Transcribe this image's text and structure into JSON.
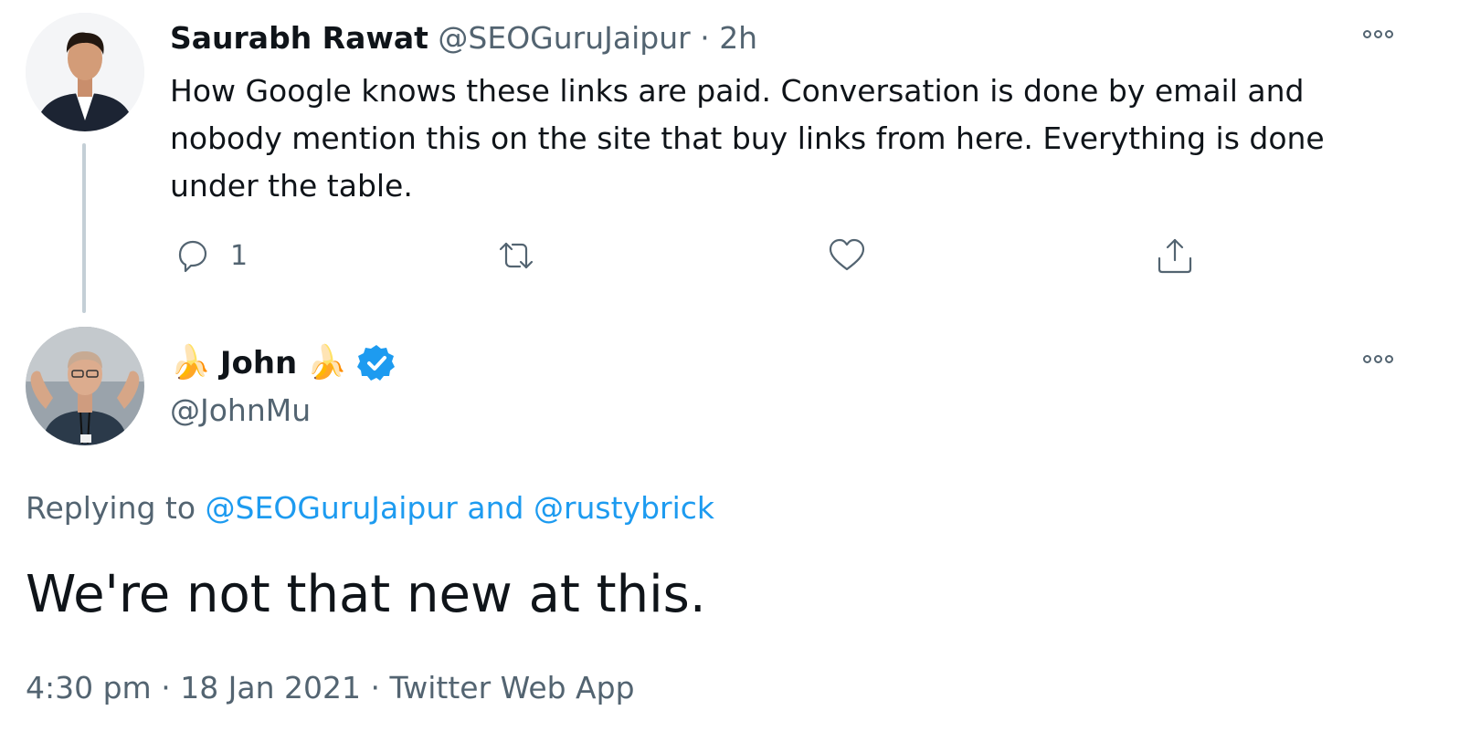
{
  "parent_tweet": {
    "author_name": "Saurabh Rawat",
    "handle": "@SEOGuruJaipur",
    "separator": "·",
    "time": "2h",
    "text": "How Google knows these links are paid. Conversation is done by email and nobody mention this on the site that buy links from here. Everything is done under the table.",
    "reply_count": "1",
    "icons": {
      "reply": "reply-icon",
      "retweet": "retweet-icon",
      "like": "heart-icon",
      "share": "share-icon",
      "more": "more-icon"
    }
  },
  "main_tweet": {
    "author_name": "John",
    "name_emoji": "🍌",
    "verified": true,
    "handle": "@JohnMu",
    "replying_prefix": "Replying to",
    "replying_users": [
      "@SEOGuruJaipur",
      "@rustybrick"
    ],
    "replying_joiner": "and",
    "text": "We're not that new at this.",
    "time": "4:30 pm",
    "date": "18 Jan 2021",
    "source": "Twitter Web App",
    "separator": "·"
  },
  "colors": {
    "text": "#0f1419",
    "muted": "#536471",
    "link": "#1d9bf0",
    "thread_line": "#c4cfd6",
    "verified": "#1d9bf0"
  }
}
